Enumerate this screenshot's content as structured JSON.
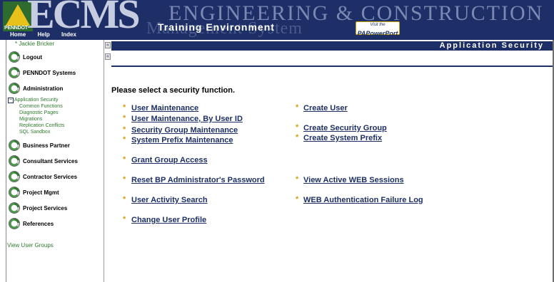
{
  "header": {
    "logo_text": "PENNDOT",
    "ecms_mark": "ECMS",
    "engineering_title": "ENGINEERING & CONSTRUCTION",
    "management_subtitle": "Management System",
    "environment_label": "Training Environment",
    "pa_power": {
      "visit_text": "Visit the",
      "brand_text": "PAPowerPort"
    },
    "top_nav": [
      "Home",
      "Help",
      "Index"
    ]
  },
  "sidebar": {
    "user_name": "* Jackie Bricker",
    "items": [
      {
        "label": "Logout"
      },
      {
        "label": "PENNDOT Systems"
      },
      {
        "label": "Administration"
      }
    ],
    "admin_sublinks": [
      "Application Security",
      "Common Functions",
      "Diagnostic Pages",
      "Migrations",
      "Replication Conflicts",
      "SQL Sandbox"
    ],
    "more_items": [
      {
        "label": "Business Partner"
      },
      {
        "label": "Consultant Services"
      },
      {
        "label": "Contractor Services"
      },
      {
        "label": "Project Mgmt"
      },
      {
        "label": "Project Services"
      },
      {
        "label": "References"
      }
    ],
    "view_user_groups": "View User Groups"
  },
  "main": {
    "page_title": "Application Security",
    "prompt": "Please select a security function.",
    "left_links": [
      "User Maintenance",
      "User Maintenance, By User ID",
      "Security Group Maintenance",
      "System Prefix Maintenance",
      "Grant Group Access",
      "Reset BP Administrator's Password",
      "User Activity Search",
      "Change User Profile"
    ],
    "right_links": [
      "Create User",
      "Create Security Group",
      "Create System Prefix",
      "View Active WEB Sessions",
      "WEB Authentication Failure Log"
    ],
    "bullet_char": "*"
  },
  "colors": {
    "navy": "#1d2f66",
    "sidebar_green": "#2d7a2d",
    "bullet_gold": "#d4a017"
  }
}
